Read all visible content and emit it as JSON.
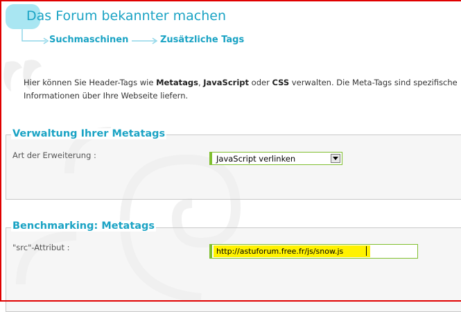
{
  "page": {
    "title": "Das Forum bekannter machen",
    "breadcrumb": [
      "Suchmaschinen",
      "Zusätzliche Tags"
    ]
  },
  "intro": {
    "line1_a": "Hier können Sie Header-Tags wie ",
    "line1_b": "Metatags",
    "line1_c": ", ",
    "line1_d": "JavaScript",
    "line1_e": " oder ",
    "line1_f": "CSS",
    "line1_g": " verwalten. Die Meta-Tags sind spezifische",
    "line2": "Informationen über Ihre Webseite liefern."
  },
  "sections": [
    {
      "legend": "Verwaltung Ihrer Metatags",
      "field_label": "Art der Erweiterung :",
      "select_value": "JavaScript verlinken"
    },
    {
      "legend": "Benchmarking: Metatags",
      "field_label": "\"src\"-Attribut :",
      "input_value": "http://astuforum.free.fr/js/snow.js"
    }
  ],
  "colors": {
    "accent": "#1aa3c4",
    "field_border": "#7fbf2e",
    "highlight": "#fff200",
    "frame": "#e00000"
  },
  "icons": [
    "select-arrow-icon",
    "breadcrumb-arrow-icon",
    "quote-decoration",
    "swirl-decoration"
  ]
}
